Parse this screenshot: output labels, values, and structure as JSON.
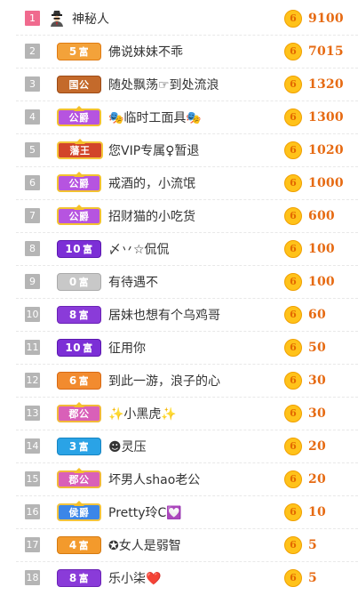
{
  "leaderboard": {
    "coin_glyph": "6",
    "rows": [
      {
        "rank": "1",
        "badge": null,
        "badge_style": "none",
        "avatar": "spy-icon",
        "nickname": "神秘人",
        "amount": "9100"
      },
      {
        "rank": "2",
        "badge": {
          "num": "5",
          "text": "富"
        },
        "badge_style": "b-fu5",
        "avatar": null,
        "nickname": "佛说妹妹不乖",
        "amount": "7015"
      },
      {
        "rank": "3",
        "badge": {
          "num": "",
          "text": "国公"
        },
        "badge_style": "b-guogong",
        "avatar": null,
        "nickname": "随处飘荡☞到处流浪",
        "amount": "1320"
      },
      {
        "rank": "4",
        "badge": {
          "num": "",
          "text": "公爵"
        },
        "badge_style": "b-gongjue",
        "avatar": null,
        "nickname": "🎭临时工面具🎭",
        "amount": "1300"
      },
      {
        "rank": "5",
        "badge": {
          "num": "",
          "text": "藩王"
        },
        "badge_style": "b-fanwang",
        "avatar": null,
        "nickname": "您VIP专属♀暂退",
        "amount": "1020"
      },
      {
        "rank": "6",
        "badge": {
          "num": "",
          "text": "公爵"
        },
        "badge_style": "b-gongjue",
        "avatar": null,
        "nickname": "戒酒的，小流氓",
        "amount": "1000"
      },
      {
        "rank": "7",
        "badge": {
          "num": "",
          "text": "公爵"
        },
        "badge_style": "b-gongjue",
        "avatar": null,
        "nickname": "招财猫的小吃货",
        "amount": "600"
      },
      {
        "rank": "8",
        "badge": {
          "num": "10",
          "text": "富"
        },
        "badge_style": "b-fu10",
        "avatar": null,
        "nickname": "〆丷☆侃侃",
        "amount": "100"
      },
      {
        "rank": "9",
        "badge": {
          "num": "0",
          "text": "富"
        },
        "badge_style": "b-fu0",
        "avatar": null,
        "nickname": "有待遇不",
        "amount": "100"
      },
      {
        "rank": "10",
        "badge": {
          "num": "8",
          "text": "富"
        },
        "badge_style": "b-fu8",
        "avatar": null,
        "nickname": "居妹也想有个乌鸡哥",
        "amount": "60"
      },
      {
        "rank": "11",
        "badge": {
          "num": "10",
          "text": "富"
        },
        "badge_style": "b-fu10",
        "avatar": null,
        "nickname": "征用你",
        "amount": "50"
      },
      {
        "rank": "12",
        "badge": {
          "num": "6",
          "text": "富"
        },
        "badge_style": "b-fu6",
        "avatar": null,
        "nickname": "到此一游，浪子的心",
        "amount": "30"
      },
      {
        "rank": "13",
        "badge": {
          "num": "",
          "text": "郡公"
        },
        "badge_style": "b-jungong",
        "avatar": null,
        "nickname": "✨小黑虎✨",
        "amount": "30"
      },
      {
        "rank": "14",
        "badge": {
          "num": "3",
          "text": "富"
        },
        "badge_style": "b-fu3",
        "avatar": null,
        "nickname": "☻灵压",
        "amount": "20"
      },
      {
        "rank": "15",
        "badge": {
          "num": "",
          "text": "郡公"
        },
        "badge_style": "b-jungong",
        "avatar": null,
        "nickname": "坏男人shao老公",
        "amount": "20"
      },
      {
        "rank": "16",
        "badge": {
          "num": "",
          "text": "侯爵"
        },
        "badge_style": "b-houjue",
        "avatar": null,
        "nickname": "Pretty玲C💟",
        "amount": "10"
      },
      {
        "rank": "17",
        "badge": {
          "num": "4",
          "text": "富"
        },
        "badge_style": "b-fu4",
        "avatar": null,
        "nickname": "✪女人是弱智",
        "amount": "5"
      },
      {
        "rank": "18",
        "badge": {
          "num": "8",
          "text": "富"
        },
        "badge_style": "b-fu8",
        "avatar": null,
        "nickname": "乐小柒❤️",
        "amount": "5"
      }
    ]
  }
}
